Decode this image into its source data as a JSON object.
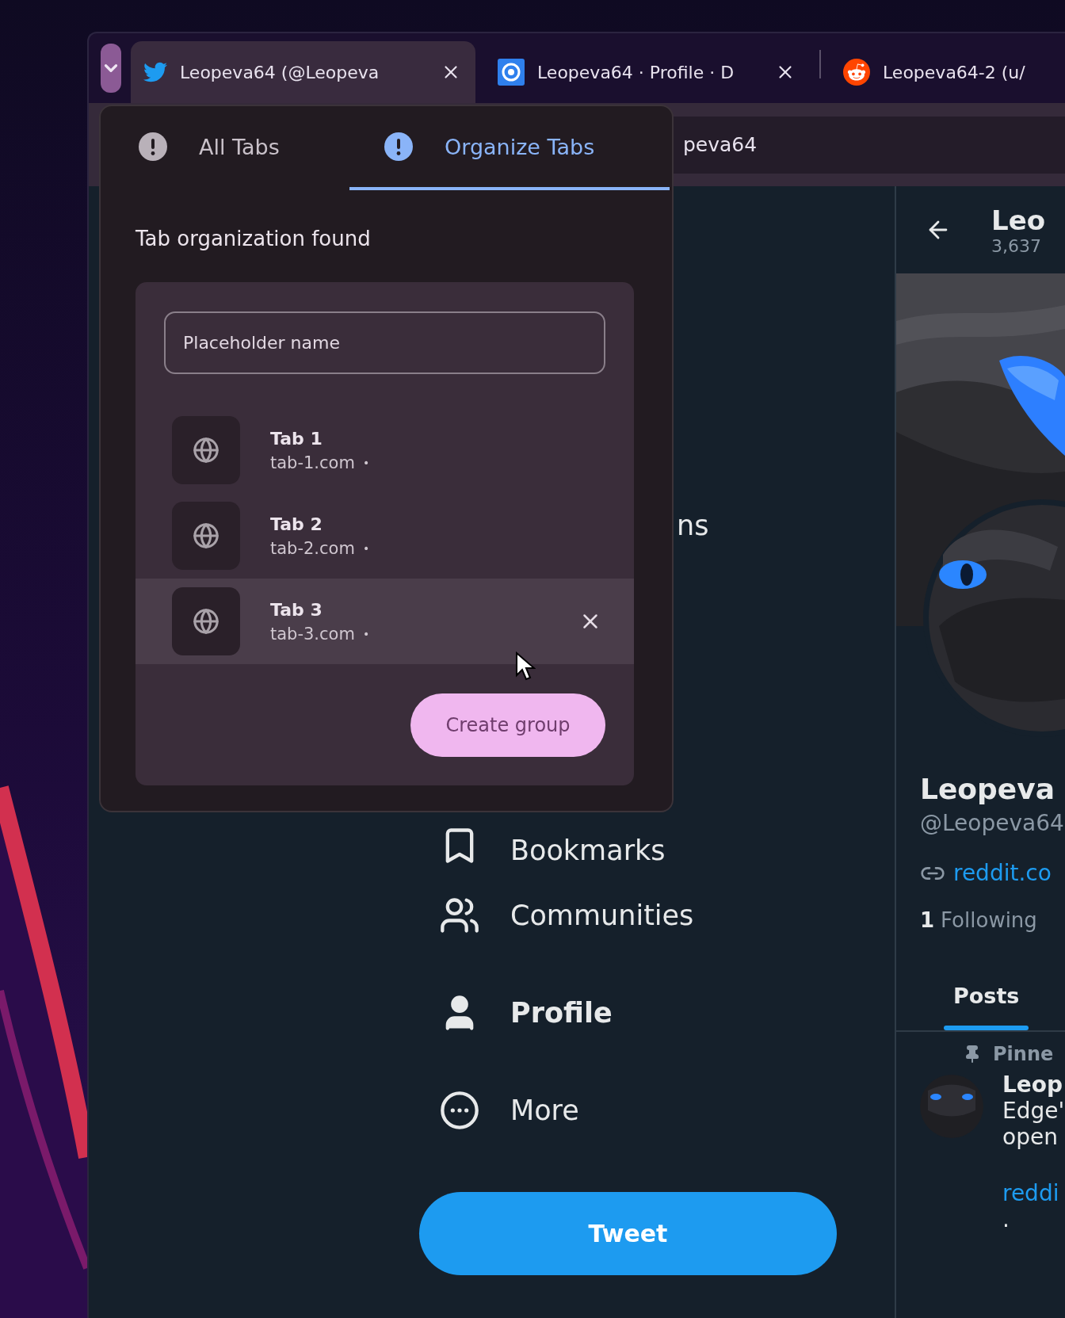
{
  "browser_tabs": [
    {
      "title": "Leopeva64 (@Leopeva",
      "kind": "bird",
      "selected": true
    },
    {
      "title": "Leopeva64 · Profile · D",
      "kind": "square",
      "selected": false
    },
    {
      "title": "Leopeva64-2 (u/",
      "kind": "reddit",
      "selected": false
    }
  ],
  "address_bar": {
    "value": "peva64"
  },
  "popup": {
    "tabs": [
      {
        "label": "All Tabs",
        "selected": false
      },
      {
        "label": "Organize Tabs",
        "selected": true
      }
    ],
    "heading": "Tab organization found",
    "name_field": {
      "placeholder": "Placeholder name"
    },
    "tab_list": [
      {
        "title": "Tab 1",
        "url": "tab-1.com",
        "dot": "•",
        "hovered": false
      },
      {
        "title": "Tab 2",
        "url": "tab-2.com",
        "dot": "•",
        "hovered": false
      },
      {
        "title": "Tab 3",
        "url": "tab-3.com",
        "dot": "•",
        "hovered": true
      }
    ],
    "button": "Create group"
  },
  "nav": [
    {
      "label": "ns",
      "kind": "cut",
      "selected": false
    },
    {
      "label": "Bookmarks",
      "kind": "bookmark",
      "selected": false
    },
    {
      "label": "Communities",
      "kind": "communities",
      "selected": false
    },
    {
      "label": "Profile",
      "kind": "profile",
      "selected": true
    },
    {
      "label": "More",
      "kind": "more",
      "selected": false
    }
  ],
  "tweet_button": "Tweet",
  "profile": {
    "header_name": "Leo",
    "post_count": "3,637",
    "name": "Leopeva",
    "handle": "@Leopeva64",
    "link": "reddit.co",
    "following_count": "1",
    "following_label": "Following",
    "tabs": [
      {
        "label": "Posts",
        "selected": true
      }
    ],
    "pinned_label": "Pinne",
    "post": {
      "author": "Leop",
      "lines": [
        "Edge'",
        "open"
      ],
      "link": "reddi",
      "more": "."
    }
  }
}
